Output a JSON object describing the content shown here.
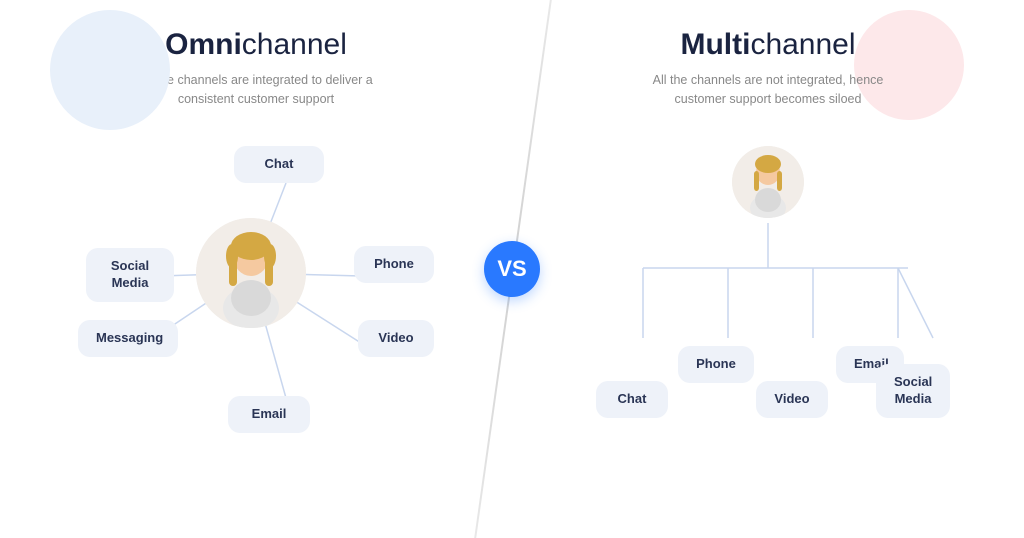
{
  "left": {
    "title_bold": "Omni",
    "title_light": "channel",
    "subtitle": "All the channels are integrated to deliver a consistent customer support",
    "channels": [
      "Chat",
      "Social\nMedia",
      "Messaging",
      "Phone",
      "Video",
      "Email"
    ]
  },
  "right": {
    "title_bold": "Multi",
    "title_light": "channel",
    "subtitle": "All the channels are not integrated, hence customer support becomes siloed",
    "channels": [
      "Chat",
      "Phone",
      "Video",
      "Email",
      "Social\nMedia"
    ]
  },
  "vs": "VS"
}
